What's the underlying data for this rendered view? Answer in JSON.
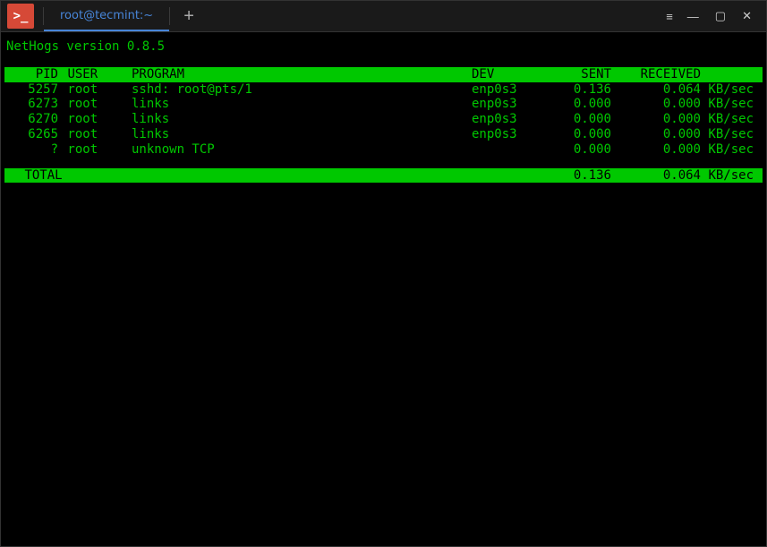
{
  "window": {
    "tab_title": "root@tecmint:~",
    "new_tab_glyph": "+",
    "hamburger": "≡",
    "minimize": "—",
    "maximize": "▢",
    "close": "✕",
    "app_icon_glyph": ">_"
  },
  "app": {
    "version_line": "NetHogs version 0.8.5"
  },
  "columns": {
    "pid": "PID",
    "user": "USER",
    "program": "PROGRAM",
    "dev": "DEV",
    "sent": "SENT",
    "received": "RECEIVED"
  },
  "rows": [
    {
      "pid": "5257",
      "user": "root",
      "program": "sshd: root@pts/1",
      "dev": "enp0s3",
      "sent": "0.136",
      "received": "0.064",
      "unit": "KB/sec"
    },
    {
      "pid": "6273",
      "user": "root",
      "program": "links",
      "dev": "enp0s3",
      "sent": "0.000",
      "received": "0.000",
      "unit": "KB/sec"
    },
    {
      "pid": "6270",
      "user": "root",
      "program": "links",
      "dev": "enp0s3",
      "sent": "0.000",
      "received": "0.000",
      "unit": "KB/sec"
    },
    {
      "pid": "6265",
      "user": "root",
      "program": "links",
      "dev": "enp0s3",
      "sent": "0.000",
      "received": "0.000",
      "unit": "KB/sec"
    },
    {
      "pid": "?",
      "user": "root",
      "program": "unknown TCP",
      "dev": "",
      "sent": "0.000",
      "received": "0.000",
      "unit": "KB/sec"
    }
  ],
  "total": {
    "label": "TOTAL",
    "sent": "0.136",
    "received": "0.064",
    "unit": "KB/sec"
  }
}
